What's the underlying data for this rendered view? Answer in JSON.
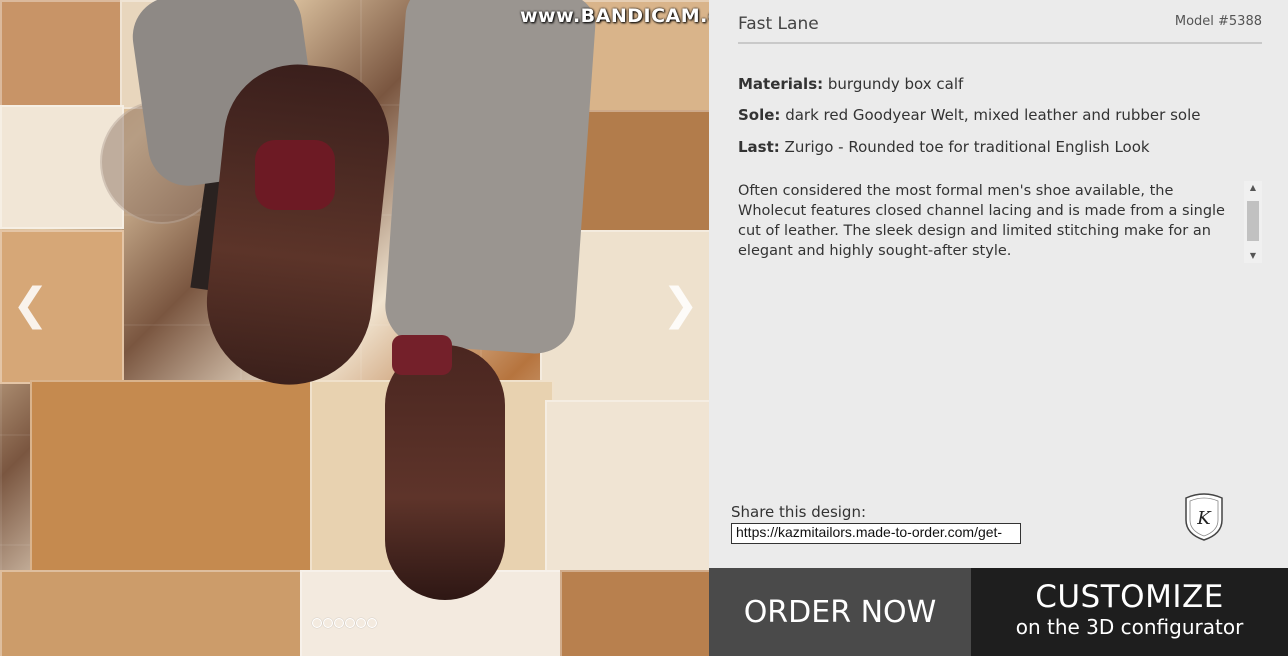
{
  "watermark": "www.BANDICAM.com",
  "carousel": {
    "prev_icon": "chevron-left-icon",
    "next_icon": "chevron-right-icon",
    "prev_glyph": "❮",
    "next_glyph": "❯",
    "slide_count": 6
  },
  "product": {
    "title": "Fast Lane",
    "model": "Model #5388",
    "materials_label": "Materials:",
    "materials_value": " burgundy box calf",
    "sole_label": "Sole:",
    "sole_value": " dark red Goodyear Welt, mixed leather and rubber sole",
    "last_label": "Last:",
    "last_value": " Zurigo - Rounded toe for traditional English Look",
    "description": "Often considered the most formal men's shoe available, the Wholecut features closed channel lacing and is made from a single cut of leather. The sleek design and limited stitching make for an elegant and highly sought-after style."
  },
  "share": {
    "label": "Share this design:",
    "url": "https://kazmitailors.made-to-order.com/get-"
  },
  "logo": {
    "letter": "K"
  },
  "buttons": {
    "order": "ORDER NOW",
    "customize_main": "CUSTOMIZE",
    "customize_sub": "on the 3D configurator"
  },
  "colors": {
    "order_bg": "#4a4a4a",
    "customize_bg": "#1e1e1e",
    "panel_bg": "#ebebeb"
  }
}
